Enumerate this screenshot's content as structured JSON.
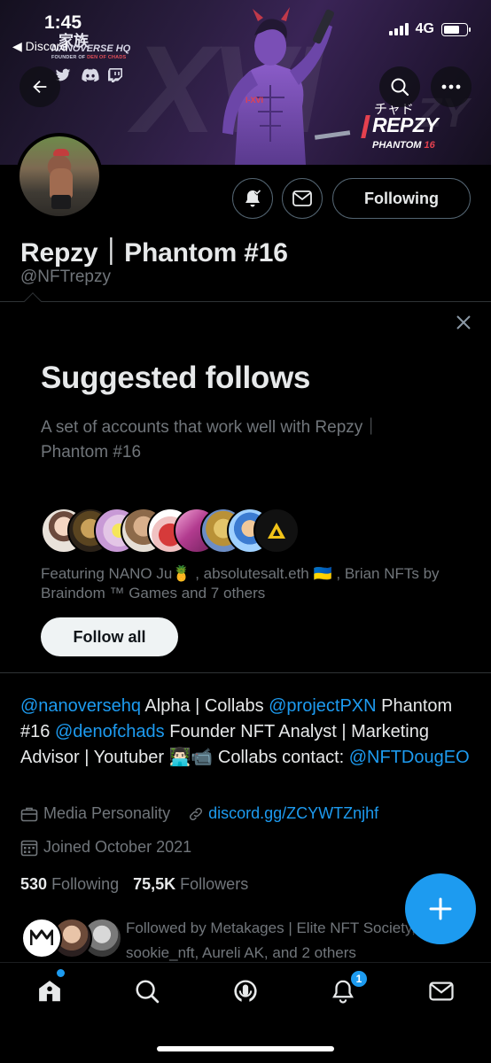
{
  "status_bar": {
    "time": "1:45",
    "back_app": "◀ Discord",
    "network": "4G",
    "signal_bars": 4,
    "battery_level": 0.7
  },
  "banner": {
    "kanji": "家族",
    "brand": "NANOVERSE HQ",
    "brand_sub_prefix": "FOUNDER OF",
    "brand_sub_accent": "DEN OF CHADS",
    "bg_text": "XVI",
    "bg_text2": "ZY",
    "badge_jp": "チャド",
    "badge_name": "REPZY",
    "badge_phantom": "PHANTOM",
    "badge_number": "16",
    "social_icons": [
      "twitter-icon",
      "discord-icon",
      "twitch-icon"
    ]
  },
  "header": {
    "back_icon": "arrow-left-icon",
    "search_icon": "search-icon",
    "more_icon": "more-horizontal-icon"
  },
  "profile": {
    "follow_button_label": "Following",
    "display_name": "Repzy｜Phantom #16",
    "handle": "@NFTrepzy"
  },
  "suggested": {
    "title": "Suggested follows",
    "description": "A set of accounts that work well with Repzy｜Phantom #16",
    "featuring": "Featuring NANO Ju🍍 , absolutesalt.eth 🇺🇦 , Brian NFTs by Braindom ™ Games and 7 others",
    "follow_all_label": "Follow all",
    "avatar_count": 8
  },
  "bio": {
    "m1": "@nanoversehq",
    "t1": " Alpha | Collabs ",
    "m2": "@projectPXN",
    "t2": " Phantom #16 ",
    "m3": "@denofchads",
    "t3": " Founder NFT Analyst | Marketing Advisor | Youtuber 👨🏻‍💻📹 Collabs contact: ",
    "m4": "@NFTDougEO"
  },
  "meta": {
    "category": "Media Personality",
    "link": "discord.gg/ZCYWTZnjhf",
    "joined": "Joined October 2021"
  },
  "stats": {
    "following_count": "530",
    "following_label": "Following",
    "followers_count": "75,5K",
    "followers_label": "Followers"
  },
  "followed_by": {
    "line1": "Followed by Metakages | Elite NFT Society,",
    "line2": "sookie_nft, Aureli AK, and 2 others"
  },
  "tabbar": {
    "notification_count": "1"
  },
  "colors": {
    "accent": "#1d9bf0",
    "muted_text": "#71767b",
    "primary_text": "#e7e9ea",
    "background": "#000000",
    "brand_red": "#e5414f"
  }
}
